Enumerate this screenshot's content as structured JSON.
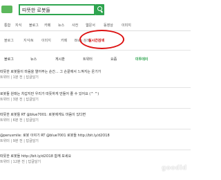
{
  "search": {
    "query": "따뜻한 로봇들"
  },
  "nav": [
    "통합",
    "지식",
    "블로그",
    "카페",
    "뉴스",
    "사전",
    "웹문서",
    "동영상",
    "이미지"
  ],
  "subtabs": [
    "블로그",
    "지식iN",
    "이미지",
    "카페",
    "Blog 검색",
    "실시간검색"
  ],
  "subtabs_active_index": 5,
  "categories": [
    "블로그",
    "뉴스",
    "게시판",
    "트위터",
    "요즘",
    "미투데이"
  ],
  "categories_selected_index": 5,
  "results": [
    {
      "line1": "따뜻한 로봇들이 마음을 열어주는 순간... 그 손끝에서 느껴지는 온기가",
      "meta": "트위터 | 1분 전 | 답글달기"
    },
    {
      "line1": "로봇들 원래는 차갑지만 우리가 따뜻하게 만들어 줄 수 있어요 (^ ^)",
      "meta": "트위터 | 3분 전 | 답글달기"
    },
    {
      "line1": "따뜻한 로봇들 RT @blue7001: 로봇에게도 마음이 있다면",
      "meta": "트위터 | 6분 전 | 답글달기"
    },
    {
      "line1": "@perusmile: 로봇 이야기 RT @blue7001 로봇들 http://bit.ly/d2O18",
      "meta": "트위터 | 9분 전 | 답글달기"
    },
    {
      "line1": "따뜻한 로봇들 http://bit.ly/d2O18 함께 보세요",
      "meta": "트위터 | 12분 전 | 답글달기"
    }
  ],
  "watermark": "goodid"
}
